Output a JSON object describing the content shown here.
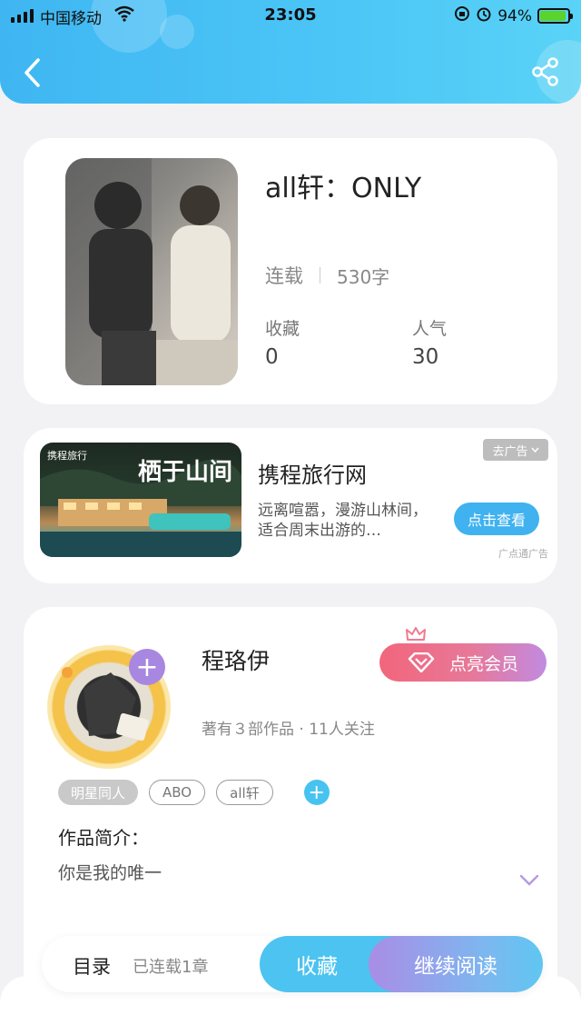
{
  "status_bar": {
    "carrier": "中国移动",
    "time": "23:05",
    "battery": "94%",
    "battery_level": 0.94
  },
  "header": {
    "back_icon": "chevron-left-icon",
    "share_icon": "share-icon"
  },
  "book": {
    "title": "all轩：ONLY",
    "status": "连载",
    "word_count": "530字",
    "favorites_label": "收藏",
    "favorites_value": "0",
    "popularity_label": "人气",
    "popularity_value": "30"
  },
  "ad": {
    "brand": "携程旅行",
    "image_text": "栖于山间",
    "title": "携程旅行网",
    "description": "远离喧嚣，漫游山林间，适合周末出游的…",
    "remove_label": "去广告",
    "cta_label": "点击查看",
    "source": "广点通广告"
  },
  "author": {
    "name": "程珞伊",
    "meta": "著有３部作品 · 11人关注",
    "vip_label": "点亮会员",
    "tags": [
      "明星同人",
      "ABO",
      "all轩"
    ],
    "intro_label": "作品简介：",
    "intro_text": "你是我的唯一"
  },
  "bottom_bar": {
    "toc_label": "目录",
    "chapters_label": "已连载1章",
    "favorite_label": "收藏",
    "continue_label": "继续阅读"
  },
  "colors": {
    "header_gradient_start": "#3fb6f2",
    "accent_blue": "#4cc3f0",
    "accent_purple": "#a887e0",
    "vip_pink": "#f2667b"
  }
}
